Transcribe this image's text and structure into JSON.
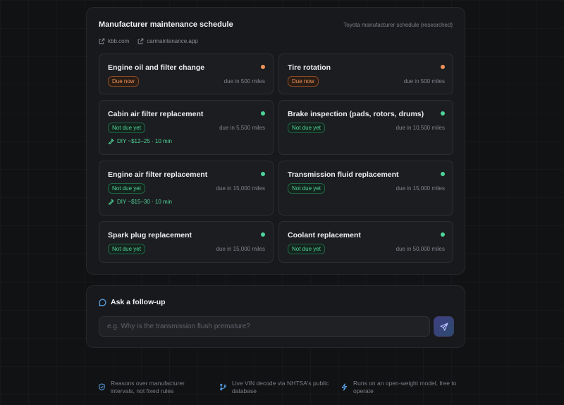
{
  "schedule": {
    "title": "Manufacturer maintenance schedule",
    "subtitle": "Toyota manufacturer schedule (researched)",
    "sources": [
      "kbb.com",
      "carmaintenance.app"
    ],
    "colors": {
      "due": "#f0935a",
      "ok": "#4fd49a"
    },
    "items": [
      {
        "title": "Engine oil and filter change",
        "status": "Due now",
        "status_type": "due",
        "due": "due in 500 miles",
        "diy": ""
      },
      {
        "title": "Tire rotation",
        "status": "Due now",
        "status_type": "due",
        "due": "due in 500 miles",
        "diy": ""
      },
      {
        "title": "Cabin air filter replacement",
        "status": "Not due yet",
        "status_type": "ok",
        "due": "due in 5,500 miles",
        "diy": "DIY ~$12–25 · 10 min"
      },
      {
        "title": "Brake inspection (pads, rotors, drums)",
        "status": "Not due yet",
        "status_type": "ok",
        "due": "due in 10,500 miles",
        "diy": ""
      },
      {
        "title": "Engine air filter replacement",
        "status": "Not due yet",
        "status_type": "ok",
        "due": "due in 15,000 miles",
        "diy": "DIY ~$15–30 · 10 min"
      },
      {
        "title": "Transmission fluid replacement",
        "status": "Not due yet",
        "status_type": "ok",
        "due": "due in 15,000 miles",
        "diy": ""
      },
      {
        "title": "Spark plug replacement",
        "status": "Not due yet",
        "status_type": "ok",
        "due": "due in 15,000 miles",
        "diy": ""
      },
      {
        "title": "Coolant replacement",
        "status": "Not due yet",
        "status_type": "ok",
        "due": "due in 50,000 miles",
        "diy": ""
      }
    ]
  },
  "followup": {
    "title": "Ask a follow-up",
    "placeholder": "e.g. Why is the transmission flush premature?",
    "send_icon": "send-icon"
  },
  "features": [
    {
      "icon": "shield-check-icon",
      "text": "Reasons over manufacturer intervals, not fixed rules"
    },
    {
      "icon": "git-branch-icon",
      "text": "Live VIN decode via NHTSA's public database"
    },
    {
      "icon": "lightning-icon",
      "text": "Runs on an open-weight model, free to operate"
    }
  ]
}
